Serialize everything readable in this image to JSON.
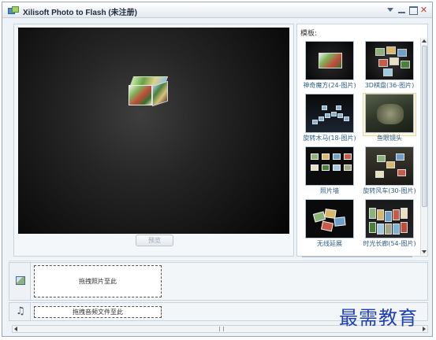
{
  "window": {
    "title": "Xilisoft Photo to Flash (未注册)",
    "controls": [
      "menu-icon",
      "minimize-icon",
      "maximize-icon",
      "close-icon"
    ]
  },
  "preview": {
    "button_label": "预览"
  },
  "templates": {
    "label": "模板:",
    "items": [
      {
        "name": "神奇魔方(24-图片)",
        "icon": "magic-cube-thumb"
      },
      {
        "name": "3D棋盘(36-图片)",
        "icon": "3d-board-thumb"
      },
      {
        "name": "旋转木马(18-图片)",
        "icon": "carousel-thumb"
      },
      {
        "name": "鱼眼镜头",
        "icon": "fisheye-thumb"
      },
      {
        "name": "照片墙",
        "icon": "photo-wall-thumb"
      },
      {
        "name": "旋转风车(30-图片)",
        "icon": "windmill-thumb"
      },
      {
        "name": "无线延展",
        "icon": "infinite-stretch-thumb"
      },
      {
        "name": "时光长廊(54-图片)",
        "icon": "time-corridor-thumb"
      }
    ]
  },
  "timeline": {
    "photo_drop": "拖拽照片至此",
    "audio_drop": "拖拽音频文件至此"
  },
  "watermark": "最需教育",
  "colors": {
    "caption": "#2f5d8a",
    "watermark": "#1f3fb5"
  }
}
